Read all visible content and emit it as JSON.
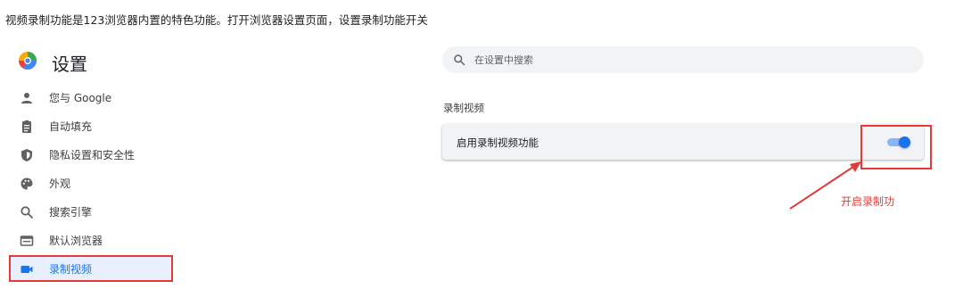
{
  "intro_text": "视频录制功能是123浏览器内置的特色功能。打开浏览器设置页面，设置录制功能开关",
  "app": {
    "title": "设置"
  },
  "sidebar": {
    "items": [
      {
        "label": "您与 Google",
        "icon": "person-icon"
      },
      {
        "label": "自动填充",
        "icon": "clipboard-icon"
      },
      {
        "label": "隐私设置和安全性",
        "icon": "shield-icon"
      },
      {
        "label": "外观",
        "icon": "palette-icon"
      },
      {
        "label": "搜索引擎",
        "icon": "search-icon"
      },
      {
        "label": "默认浏览器",
        "icon": "browser-window-icon"
      },
      {
        "label": "录制视频",
        "icon": "video-camera-icon",
        "active": true
      }
    ]
  },
  "search": {
    "placeholder": "在设置中搜索"
  },
  "section": {
    "title": "录制视频",
    "setting": {
      "label": "启用录制视频功能",
      "enabled": true
    }
  },
  "annotation": {
    "text": "开启录制功"
  },
  "colors": {
    "accent": "#1a73e8",
    "highlight": "#e53935",
    "active_bg": "#e8f0fe",
    "card_bg": "#f1f3f4"
  }
}
